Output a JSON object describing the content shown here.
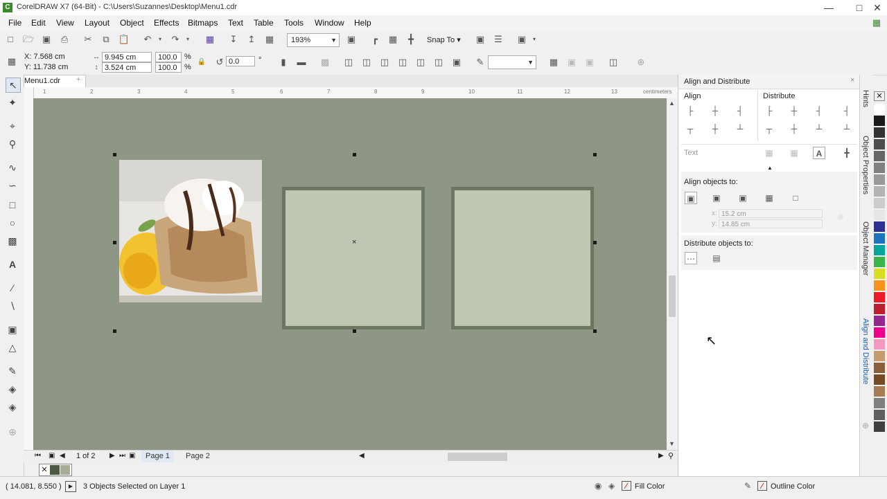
{
  "window": {
    "title": "CorelDRAW X7 (64-Bit) - C:\\Users\\Suzannes\\Desktop\\Menu1.cdr"
  },
  "menu": [
    "File",
    "Edit",
    "View",
    "Layout",
    "Object",
    "Effects",
    "Bitmaps",
    "Text",
    "Table",
    "Tools",
    "Window",
    "Help"
  ],
  "toolbar": {
    "zoom": "193%",
    "snap_to": "Snap To"
  },
  "property_bar": {
    "x": "X: 7.568 cm",
    "y": "Y: 11.738 cm",
    "width": "9.945 cm",
    "height": "3.524 cm",
    "scale_w": "100.0",
    "scale_h": "100.0",
    "pct1": "%",
    "pct2": "%",
    "rotation": "0.0",
    "deg": "°"
  },
  "document": {
    "tab": "Menu1.cdr",
    "ruler_unit": "centimeters",
    "ruler_h": [
      "1",
      "2",
      "3",
      "4",
      "5",
      "6",
      "7",
      "8",
      "9",
      "10",
      "11",
      "12",
      "13"
    ],
    "page_counter": "1 of 2",
    "pages": [
      "Page 1",
      "Page 2"
    ]
  },
  "docker": {
    "title": "Align and Distribute",
    "align_label": "Align",
    "distribute_label": "Distribute",
    "text_label": "Text",
    "align_to_label": "Align objects to:",
    "x_value": "15.2 cm",
    "y_value": "14.85 cm",
    "x_prefix": "x:",
    "y_prefix": "y:",
    "distribute_to_label": "Distribute objects to:"
  },
  "side_tabs": [
    "Hints",
    "Object Properties",
    "Object Manager",
    "Align and Distribute"
  ],
  "palette": [
    "#ffffff",
    "#1a1a1a",
    "#333333",
    "#4d4d4d",
    "#666666",
    "#808080",
    "#999999",
    "#b3b3b3",
    "#cccccc",
    "#e6e6e6",
    "#2e3192",
    "#1c75bc",
    "#00a79d",
    "#39b54a",
    "#d7df23",
    "#f7941d",
    "#ed1c24",
    "#be1e2d",
    "#92278f",
    "#ec008c",
    "#f49ac1",
    "#c69c6d",
    "#8b5e3c",
    "#754c24",
    "#a67c52",
    "#7f7f7f",
    "#5f5f5f",
    "#3f3f3f"
  ],
  "status": {
    "coords": "( 14.081, 8.550 )",
    "selection": "3 Objects Selected on Layer 1",
    "fill": "Fill Color",
    "outline": "Outline Color"
  },
  "colors": {
    "canvas": "#8e9685",
    "frame_border": "#6b7660",
    "frame_fill": "#c0c6b4"
  }
}
